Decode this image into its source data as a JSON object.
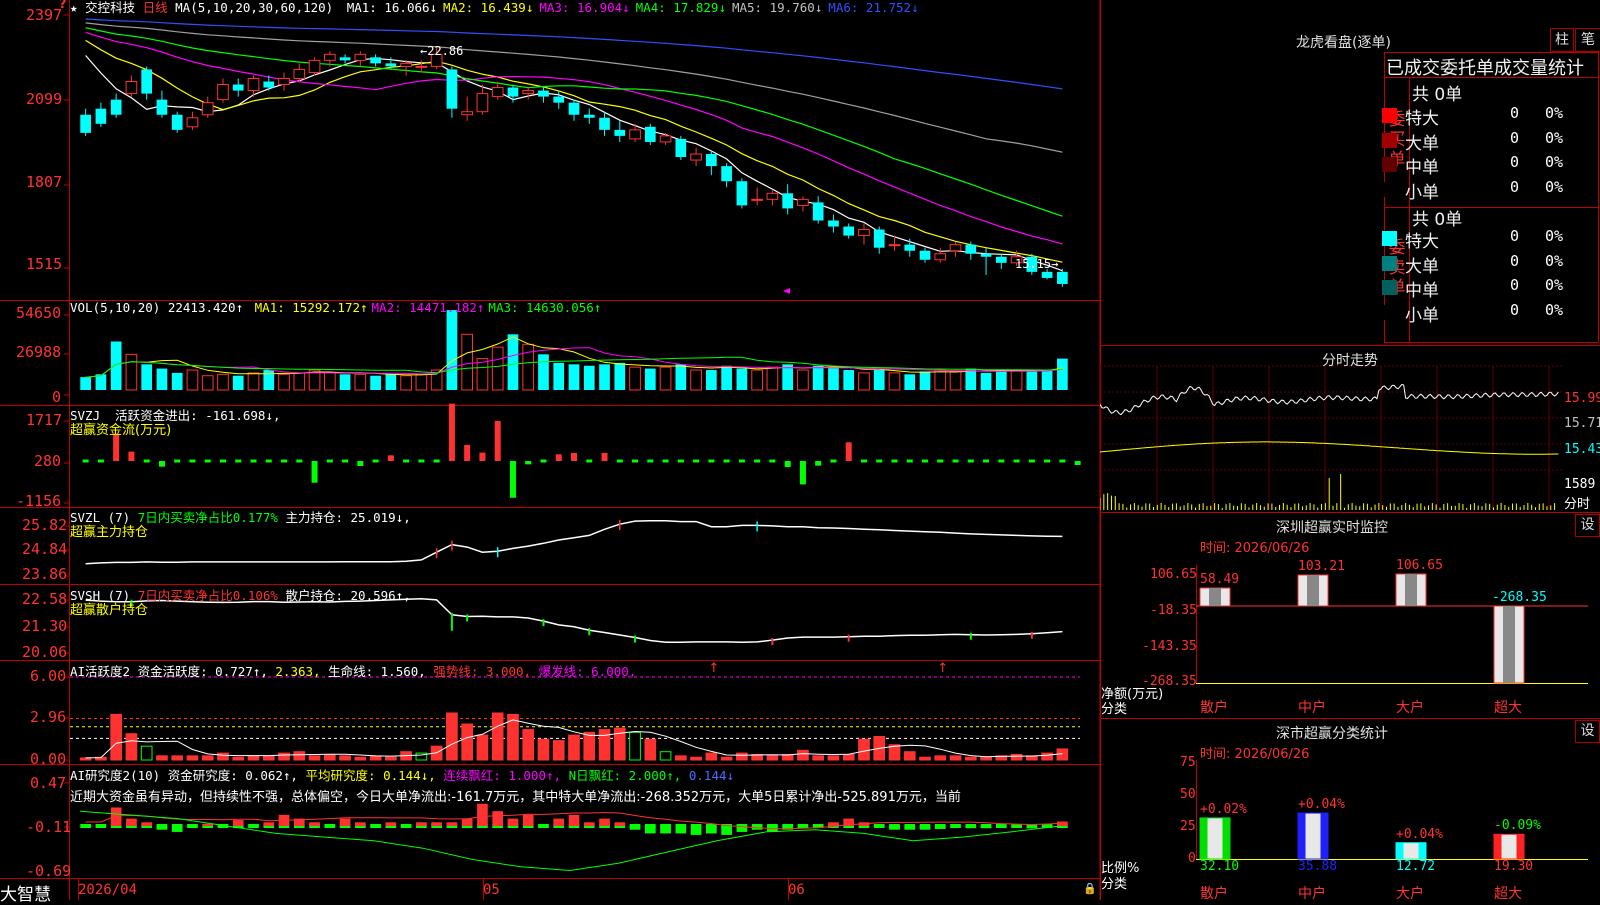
{
  "app": {
    "name": "大智慧"
  },
  "stock": {
    "name": "交控科技",
    "period": "日线"
  },
  "price_pane": {
    "ma_title": "MA(5,10,20,30,60,120)",
    "ma_items": [
      {
        "label": "MA1:",
        "value": "16.066↓",
        "color": "#ffffff"
      },
      {
        "label": "MA2:",
        "value": "16.439↓",
        "color": "#ffff00"
      },
      {
        "label": "MA3:",
        "value": "16.904↓",
        "color": "#ff00ff"
      },
      {
        "label": "MA4:",
        "value": "17.829↓",
        "color": "#00ff00"
      },
      {
        "label": "MA5:",
        "value": "19.760↓",
        "color": "#c0c0c0"
      },
      {
        "label": "MA6:",
        "value": "21.752↓",
        "color": "#3050ff"
      }
    ],
    "y_ticks": [
      "2397",
      "2099",
      "1807",
      "1515"
    ],
    "high_label": "22.86",
    "low_label": "15.15"
  },
  "vol_pane": {
    "title": "VOL(5,10,20)",
    "value": "22413.420↑",
    "ma_items": [
      {
        "label": "MA1:",
        "value": "15292.172↑",
        "color": "#ffff00"
      },
      {
        "label": "MA2:",
        "value": "14471.182↑",
        "color": "#ff00ff"
      },
      {
        "label": "MA3:",
        "value": "14630.056↑",
        "color": "#00ff00"
      }
    ],
    "y_ticks": [
      "54650",
      "26988",
      "0"
    ]
  },
  "svzj_pane": {
    "title": "SVZJ",
    "label": "活跃资金进出:",
    "value": "-161.698↓,",
    "sub": "超赢资金流(万元)",
    "y_ticks": [
      "1717",
      "280",
      "-1156"
    ]
  },
  "svzl_pane": {
    "title": "SVZL (7)",
    "label1": "7日内买卖净占比0.177%",
    "label2": "主力持仓:",
    "value": "25.019↓,",
    "sub": "超赢主力持仓",
    "y_ticks": [
      "25.82",
      "24.84",
      "23.86"
    ]
  },
  "svsh_pane": {
    "title": "SVSH (7)",
    "label1": "7日内买卖净占比0.106%",
    "label2": "散户持仓:",
    "value": "20.596↑,",
    "sub": "超赢散户持仓",
    "y_ticks": [
      "22.58",
      "21.30",
      "20.06"
    ]
  },
  "ai1_pane": {
    "title": "AI活跃度2",
    "label": "资金活跃度:",
    "v1": "0.727↑,",
    "v2": "2.363,",
    "l3": "生命线:",
    "v3": "1.560,",
    "l4": "强势线:",
    "v4": "3.000,",
    "l5": "爆发线:",
    "v5": "6.000,",
    "y_ticks": [
      "6.00",
      "2.96",
      "0.00"
    ]
  },
  "ai2_pane": {
    "title": "AI研究度2(10)",
    "l1": "资金研究度:",
    "v1": "0.062↑,",
    "l2": "平均研究度:",
    "v2": "0.144↓,",
    "l3": "连续飘红:",
    "v3": "1.000↑,",
    "l4": "N日飘红:",
    "v4": "2.000↑,",
    "v5": "0.144↓",
    "comment": "近期大资金虽有异动，但持续性不强，总体偏空，今日大单净流出:-161.7万元，其中特大单净流出:-268.352万元，大单5日累计净出-525.891万元，当前",
    "y_ticks": [
      "0.47",
      "-0.11",
      "-0.69"
    ]
  },
  "x_axis": {
    "labels": [
      "2026/04",
      "05",
      "06"
    ]
  },
  "dragon": {
    "title": "龙虎看盘(逐单)",
    "btn1": "柱",
    "btn2": "笔",
    "header": "已成交委托单成交量统计",
    "buy": {
      "side": "委买单",
      "total": "共 0单",
      "rows": [
        {
          "label": "特大",
          "count": "0",
          "pct": "0%",
          "color": "#ff0000"
        },
        {
          "label": "大单",
          "count": "0",
          "pct": "0%",
          "color": "#a00000"
        },
        {
          "label": "中单",
          "count": "0",
          "pct": "0%",
          "color": "#600000"
        },
        {
          "label": "小单",
          "count": "0",
          "pct": "0%",
          "color": "#000000"
        }
      ]
    },
    "sell": {
      "side": "委卖单",
      "total": "共 0单",
      "rows": [
        {
          "label": "特大",
          "count": "0",
          "pct": "0%",
          "color": "#00ffff"
        },
        {
          "label": "大单",
          "count": "0",
          "pct": "0%",
          "color": "#008080"
        },
        {
          "label": "中单",
          "count": "0",
          "pct": "0%",
          "color": "#006060"
        },
        {
          "label": "小单",
          "count": "0",
          "pct": "0%",
          "color": "#000000"
        }
      ]
    }
  },
  "intraday": {
    "title": "分时走势",
    "y_ticks": [
      "15.99",
      "15.71",
      "15.43",
      "1589",
      "分时"
    ]
  },
  "monitor": {
    "title": "深圳超赢实时监控",
    "btn": "设",
    "time": "时间: 2026/06/26",
    "y_ticks": [
      "106.65",
      "-18.35",
      "-143.35",
      "-268.35"
    ],
    "y_unit": "净额(万元)",
    "x_unit": "分类",
    "bars": [
      {
        "cat": "散户",
        "value": 58.49,
        "label": "58.49"
      },
      {
        "cat": "中户",
        "value": 103.21,
        "label": "103.21"
      },
      {
        "cat": "大户",
        "value": 106.65,
        "label": "106.65"
      },
      {
        "cat": "超大",
        "value": -268.35,
        "label": "-268.35"
      }
    ]
  },
  "classify": {
    "title": "深市超赢分类统计",
    "btn": "设",
    "time": "时间: 2026/06/26",
    "y_ticks": [
      "75",
      "50",
      "25",
      "0"
    ],
    "y_unit": "比例%",
    "x_unit": "分类",
    "bars": [
      {
        "cat": "散户",
        "value": 32.1,
        "label": "32.10",
        "delta": "+0.02%",
        "color": "#00e000"
      },
      {
        "cat": "中户",
        "value": 35.88,
        "label": "35.88",
        "delta": "+0.04%",
        "color": "#2020ff"
      },
      {
        "cat": "大户",
        "value": 12.72,
        "label": "12.72",
        "delta": "+0.04%",
        "color": "#00ffff"
      },
      {
        "cat": "超大",
        "value": 19.3,
        "label": "19.30",
        "delta": "-0.09%",
        "color": "#ff2020"
      }
    ]
  },
  "chart_data": {
    "type": "candlestick",
    "instrument": "交控科技",
    "price_ylim": [
      14.8,
      24.0
    ],
    "candles": [
      [
        20.6,
        20.0,
        20.8,
        19.9
      ],
      [
        20.8,
        20.3,
        21.0,
        20.2
      ],
      [
        21.1,
        20.6,
        21.3,
        20.5
      ],
      [
        21.3,
        21.7,
        21.9,
        21.2
      ],
      [
        22.1,
        21.3,
        22.2,
        21.1
      ],
      [
        21.1,
        20.6,
        21.4,
        20.5
      ],
      [
        20.6,
        20.1,
        20.7,
        20.0
      ],
      [
        20.2,
        20.5,
        20.7,
        20.1
      ],
      [
        20.6,
        21.0,
        21.2,
        20.5
      ],
      [
        21.1,
        21.6,
        21.8,
        21.0
      ],
      [
        21.6,
        21.4,
        21.8,
        21.2
      ],
      [
        21.4,
        21.8,
        21.9,
        21.2
      ],
      [
        21.7,
        21.5,
        21.9,
        21.4
      ],
      [
        21.6,
        21.8,
        22.0,
        21.4
      ],
      [
        21.8,
        22.1,
        22.3,
        21.7
      ],
      [
        22.0,
        22.4,
        22.5,
        21.9
      ],
      [
        22.4,
        22.6,
        22.7,
        22.2
      ],
      [
        22.5,
        22.4,
        22.6,
        22.3
      ],
      [
        22.4,
        22.6,
        22.7,
        22.2
      ],
      [
        22.5,
        22.3,
        22.6,
        22.2
      ],
      [
        22.3,
        22.2,
        22.5,
        22.1
      ],
      [
        22.2,
        22.3,
        22.4,
        21.9
      ],
      [
        22.2,
        22.2,
        22.4,
        22.0
      ],
      [
        22.2,
        22.6,
        22.86,
        22.1
      ],
      [
        22.1,
        20.8,
        22.2,
        20.5
      ],
      [
        20.6,
        20.7,
        21.2,
        20.4
      ],
      [
        20.7,
        21.3,
        21.6,
        20.6
      ],
      [
        21.2,
        21.5,
        21.7,
        21.1
      ],
      [
        21.5,
        21.2,
        21.6,
        21.0
      ],
      [
        21.3,
        21.4,
        21.5,
        21.1
      ],
      [
        21.4,
        21.2,
        21.5,
        21.0
      ],
      [
        21.2,
        21.0,
        21.4,
        20.8
      ],
      [
        21.0,
        20.6,
        21.1,
        20.4
      ],
      [
        20.6,
        20.5,
        20.8,
        20.3
      ],
      [
        20.5,
        20.1,
        20.7,
        19.9
      ],
      [
        20.1,
        19.9,
        20.4,
        19.7
      ],
      [
        19.8,
        20.1,
        20.3,
        19.7
      ],
      [
        20.2,
        19.7,
        20.3,
        19.6
      ],
      [
        19.7,
        19.9,
        20.0,
        19.6
      ],
      [
        19.8,
        19.2,
        19.9,
        19.1
      ],
      [
        19.1,
        19.3,
        19.5,
        18.9
      ],
      [
        19.3,
        18.9,
        19.4,
        18.6
      ],
      [
        18.9,
        18.4,
        19.0,
        18.2
      ],
      [
        18.4,
        17.6,
        18.5,
        17.5
      ],
      [
        17.8,
        17.8,
        18.2,
        17.6
      ],
      [
        17.8,
        18.0,
        18.1,
        17.6
      ],
      [
        18.0,
        17.5,
        18.3,
        17.3
      ],
      [
        17.6,
        17.8,
        17.9,
        17.4
      ],
      [
        17.7,
        17.1,
        17.9,
        17.0
      ],
      [
        17.1,
        16.9,
        17.3,
        16.7
      ],
      [
        16.9,
        16.6,
        17.0,
        16.5
      ],
      [
        16.6,
        16.8,
        17.0,
        16.3
      ],
      [
        16.8,
        16.2,
        16.9,
        16.0
      ],
      [
        16.3,
        16.3,
        16.6,
        16.1
      ],
      [
        16.3,
        16.1,
        16.5,
        15.9
      ],
      [
        16.1,
        15.8,
        16.2,
        15.7
      ],
      [
        15.8,
        16.0,
        16.2,
        15.7
      ],
      [
        16.1,
        16.3,
        16.4,
        15.9
      ],
      [
        16.3,
        16.0,
        16.4,
        15.8
      ],
      [
        16.0,
        15.9,
        16.2,
        15.3
      ],
      [
        15.9,
        15.7,
        16.0,
        15.5
      ],
      [
        15.7,
        15.9,
        16.1,
        15.6
      ],
      [
        15.9,
        15.4,
        16.0,
        15.3
      ],
      [
        15.4,
        15.2,
        15.5,
        15.15
      ],
      [
        15.4,
        15.0,
        15.5,
        14.9
      ]
    ],
    "ma_series": [
      {
        "name": "MA1",
        "color": "#ffffff"
      },
      {
        "name": "MA2",
        "color": "#ffff00"
      },
      {
        "name": "MA3",
        "color": "#ff00ff"
      },
      {
        "name": "MA4",
        "color": "#00ff00"
      },
      {
        "name": "MA5",
        "color": "#a0a0a0"
      },
      {
        "name": "MA6",
        "color": "#3050ff"
      }
    ],
    "volume": [
      9,
      11,
      34,
      25,
      18,
      15,
      12,
      14,
      10,
      11,
      10,
      12,
      14,
      11,
      12,
      14,
      12,
      11,
      11,
      10,
      11,
      10,
      11,
      14,
      56,
      39,
      22,
      30,
      39,
      32,
      25,
      19,
      18,
      17,
      18,
      19,
      16,
      15,
      16,
      18,
      14,
      14,
      17,
      15,
      14,
      16,
      18,
      14,
      17,
      16,
      14,
      12,
      14,
      12,
      11,
      13,
      14,
      13,
      15,
      12,
      14,
      14,
      13,
      14,
      22
    ],
    "svzj": [
      0,
      0,
      820,
      280,
      0,
      -170,
      0,
      0,
      0,
      0,
      0,
      0,
      0,
      0,
      0,
      -650,
      0,
      0,
      -150,
      0,
      170,
      0,
      0,
      0,
      1717,
      480,
      250,
      1200,
      -1100,
      -100,
      0,
      200,
      240,
      0,
      240,
      0,
      0,
      0,
      0,
      0,
      0,
      0,
      0,
      0,
      0,
      0,
      -180,
      -700,
      -140,
      0,
      560,
      0,
      0,
      0,
      0,
      0,
      0,
      0,
      0,
      0,
      0,
      0,
      0,
      0,
      0,
      -120
    ],
    "svzl": [
      23.95,
      23.98,
      24.0,
      24.0,
      24.02,
      24.01,
      24.01,
      24.02,
      24.02,
      24.02,
      24.02,
      24.02,
      24.02,
      24.02,
      24.02,
      24.02,
      24.02,
      24.03,
      24.03,
      24.03,
      24.03,
      24.05,
      24.1,
      24.4,
      24.7,
      24.6,
      24.4,
      24.44,
      24.55,
      24.64,
      24.75,
      24.88,
      24.97,
      25.06,
      25.3,
      25.5,
      25.62,
      25.63,
      25.63,
      25.6,
      25.6,
      25.4,
      25.4,
      25.45,
      25.45,
      25.43,
      25.4,
      25.4,
      25.36,
      25.35,
      25.33,
      25.3,
      25.28,
      25.25,
      25.23,
      25.2,
      25.18,
      25.15,
      25.12,
      25.1,
      25.08,
      25.06,
      25.04,
      25.03,
      25.02
    ],
    "svsh": [
      22.1,
      22.05,
      22.02,
      22.02,
      22.06,
      22.08,
      22.05,
      22.02,
      22.0,
      21.99,
      22.0,
      22.03,
      22.03,
      22.0,
      22.01,
      22.02,
      22.01,
      22.04,
      22.05,
      22.08,
      22.11,
      22.14,
      22.16,
      22.11,
      21.4,
      21.32,
      21.33,
      21.3,
      21.3,
      21.25,
      21.1,
      20.92,
      20.83,
      20.67,
      20.56,
      20.44,
      20.32,
      20.18,
      20.1,
      20.1,
      20.11,
      20.11,
      20.11,
      20.1,
      20.11,
      20.2,
      20.3,
      20.34,
      20.34,
      20.34,
      20.36,
      20.38,
      20.38,
      20.41,
      20.43,
      20.43,
      20.45,
      20.47,
      20.45,
      20.44,
      20.45,
      20.47,
      20.5,
      20.55,
      20.6
    ],
    "ai_activity": [
      0.15,
      0.2,
      3.3,
      1.9,
      1.0,
      0.3,
      0.3,
      0.3,
      0.3,
      0.5,
      0.2,
      0.3,
      0.3,
      0.5,
      0.6,
      0.3,
      0.4,
      0.3,
      0.2,
      0.3,
      0.2,
      0.6,
      0.5,
      1.0,
      3.4,
      2.6,
      1.8,
      3.4,
      3.3,
      2.2,
      1.5,
      1.4,
      1.8,
      2.0,
      2.2,
      2.3,
      2.0,
      1.5,
      0.6,
      0.3,
      0.2,
      0.5,
      0.2,
      0.5,
      0.4,
      0.3,
      0.4,
      0.7,
      0.3,
      0.3,
      0.4,
      1.5,
      1.7,
      1.1,
      0.6,
      0.2,
      0.3,
      0.3,
      0.2,
      0.2,
      0.3,
      0.4,
      0.3,
      0.5,
      0.8
    ],
    "ai_research": [
      0.0,
      0.0,
      0.25,
      0.1,
      0.05,
      -0.05,
      -0.08,
      0.0,
      0.03,
      0.0,
      0.08,
      0.0,
      0.05,
      0.15,
      0.1,
      0.05,
      0.0,
      0.1,
      0.05,
      0.0,
      0.05,
      0.0,
      0.05,
      0.05,
      0.05,
      0.1,
      0.3,
      0.2,
      0.1,
      0.15,
      0.02,
      0.1,
      0.15,
      0.05,
      0.1,
      0.05,
      -0.05,
      -0.1,
      -0.1,
      -0.1,
      -0.12,
      -0.1,
      -0.12,
      -0.08,
      -0.05,
      -0.08,
      -0.05,
      -0.03,
      -0.02,
      0.05,
      0.1,
      0.05,
      0.02,
      -0.05,
      -0.05,
      -0.05,
      -0.04,
      -0.02,
      -0.03,
      -0.03,
      -0.02,
      -0.02,
      -0.03,
      0.02,
      0.06
    ]
  }
}
